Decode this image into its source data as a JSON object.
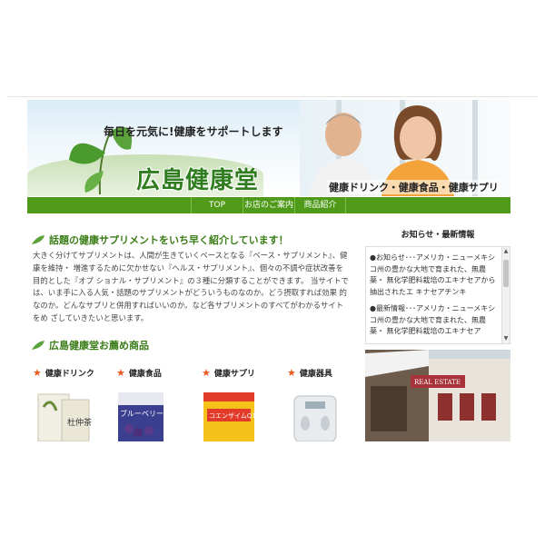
{
  "header": {
    "tagline": "毎日を元気に!健康をサポートします",
    "logo": "広島健康堂",
    "subtitle": "健康ドリンク・健康食品・健康サプリ"
  },
  "nav": {
    "items": [
      {
        "label": "TOP"
      },
      {
        "label": "お店のご案内"
      },
      {
        "label": "商品紹介"
      }
    ]
  },
  "main": {
    "headline": "話題の健康サプリメントをいち早く紹介しています！",
    "intro": "大きく分けてサプリメントは、人間が生きていくベースとなる『ベース・サプリメント』、健康を維持・ 増進するために欠かせない『ヘルス・サプリメント』、個々の不調や症状改善を目的とした『オプ ショナル・サプリメント』の３種に分類することができます。 当サイトでは、いま手に入る人気・話題のサプリメントがどういうものなのか。どう摂取すれば効果 的なのか。どんなサプリと併用すればいいのか。など各サプリメントのすべてがわかるサイトをめ ざしていきたいと思います。",
    "recommend_title": "広島健康堂お薦め商品",
    "products": [
      {
        "label": "健康ドリンク",
        "icon": "star-icon"
      },
      {
        "label": "健康食品",
        "icon": "star-icon"
      },
      {
        "label": "健康サプリ",
        "icon": "star-icon"
      },
      {
        "label": "健康器具",
        "icon": "star-icon"
      }
    ],
    "product_images": {
      "drink_text": "杜仲茶",
      "food_text": "ブルーベリー",
      "supp_text": "コエンザイムQ10"
    }
  },
  "sidebar": {
    "title": "お知らせ・最新情報",
    "news": [
      "●お知らせ･･･アメリカ・ニューメキシコ州の豊かな大地で育まれた、無農薬・ 無化学肥料栽培のエキナセアから抽出されたエ キナセアチンキ",
      "●最新情報･･･アメリカ・ニューメキシコ州の豊かな大地で育まれた、無農薬・ 無化学肥料栽培のエキナセア"
    ],
    "photo_sign": "REAL ESTATE"
  },
  "colors": {
    "nav_green": "#4f9a18",
    "heading_green": "#3a7d17",
    "star_orange": "#e9591c"
  }
}
